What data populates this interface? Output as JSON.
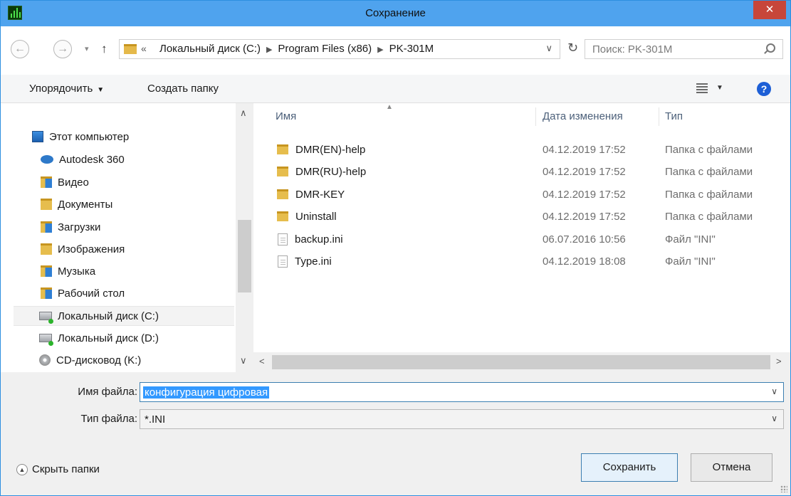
{
  "window": {
    "title": "Сохранение",
    "close_label": "✕"
  },
  "nav": {
    "breadcrumb_prefix": "«",
    "breadcrumbs": [
      "Локальный диск (C:)",
      "Program Files (x86)",
      "PK-301M"
    ],
    "search_placeholder": "Поиск: PK-301M"
  },
  "toolbar": {
    "organize_label": "Упорядочить",
    "new_folder_label": "Создать папку",
    "help_label": "?"
  },
  "sidebar": {
    "items": [
      {
        "label": "Этот компьютер",
        "icon": "computer-icon"
      },
      {
        "label": "Autodesk 360",
        "icon": "cloud-icon"
      },
      {
        "label": "Видео",
        "icon": "video-folder-icon"
      },
      {
        "label": "Документы",
        "icon": "documents-folder-icon"
      },
      {
        "label": "Загрузки",
        "icon": "downloads-folder-icon"
      },
      {
        "label": "Изображения",
        "icon": "pictures-folder-icon"
      },
      {
        "label": "Музыка",
        "icon": "music-folder-icon"
      },
      {
        "label": "Рабочий стол",
        "icon": "desktop-folder-icon"
      },
      {
        "label": "Локальный диск (C:)",
        "icon": "drive-icon",
        "selected": true
      },
      {
        "label": "Локальный диск (D:)",
        "icon": "drive-icon"
      },
      {
        "label": "CD-дисковод (K:)",
        "icon": "cd-drive-icon"
      }
    ]
  },
  "files": {
    "columns": {
      "name": "Имя",
      "date": "Дата изменения",
      "type": "Тип"
    },
    "rows": [
      {
        "name": "DMR(EN)-help",
        "date": "04.12.2019 17:52",
        "type": "Папка с файлами",
        "icon": "folder-icon"
      },
      {
        "name": "DMR(RU)-help",
        "date": "04.12.2019 17:52",
        "type": "Папка с файлами",
        "icon": "folder-icon"
      },
      {
        "name": "DMR-KEY",
        "date": "04.12.2019 17:52",
        "type": "Папка с файлами",
        "icon": "folder-icon"
      },
      {
        "name": "Uninstall",
        "date": "04.12.2019 17:52",
        "type": "Папка с файлами",
        "icon": "folder-icon"
      },
      {
        "name": "backup.ini",
        "date": "06.07.2016 10:56",
        "type": "Файл \"INI\"",
        "icon": "file-icon"
      },
      {
        "name": "Type.ini",
        "date": "04.12.2019 18:08",
        "type": "Файл \"INI\"",
        "icon": "file-icon"
      }
    ]
  },
  "form": {
    "filename_label": "Имя файла:",
    "filename_value": "конфигурация цифровая",
    "filetype_label": "Тип файла:",
    "filetype_value": "*.INI"
  },
  "footer": {
    "hide_folders_label": "Скрыть папки",
    "save_label": "Сохранить",
    "cancel_label": "Отмена"
  },
  "colors": {
    "titlebar": "#4fa3ee",
    "close": "#c7463a",
    "selection": "#3399ff",
    "folder": "#e6bd4d"
  }
}
